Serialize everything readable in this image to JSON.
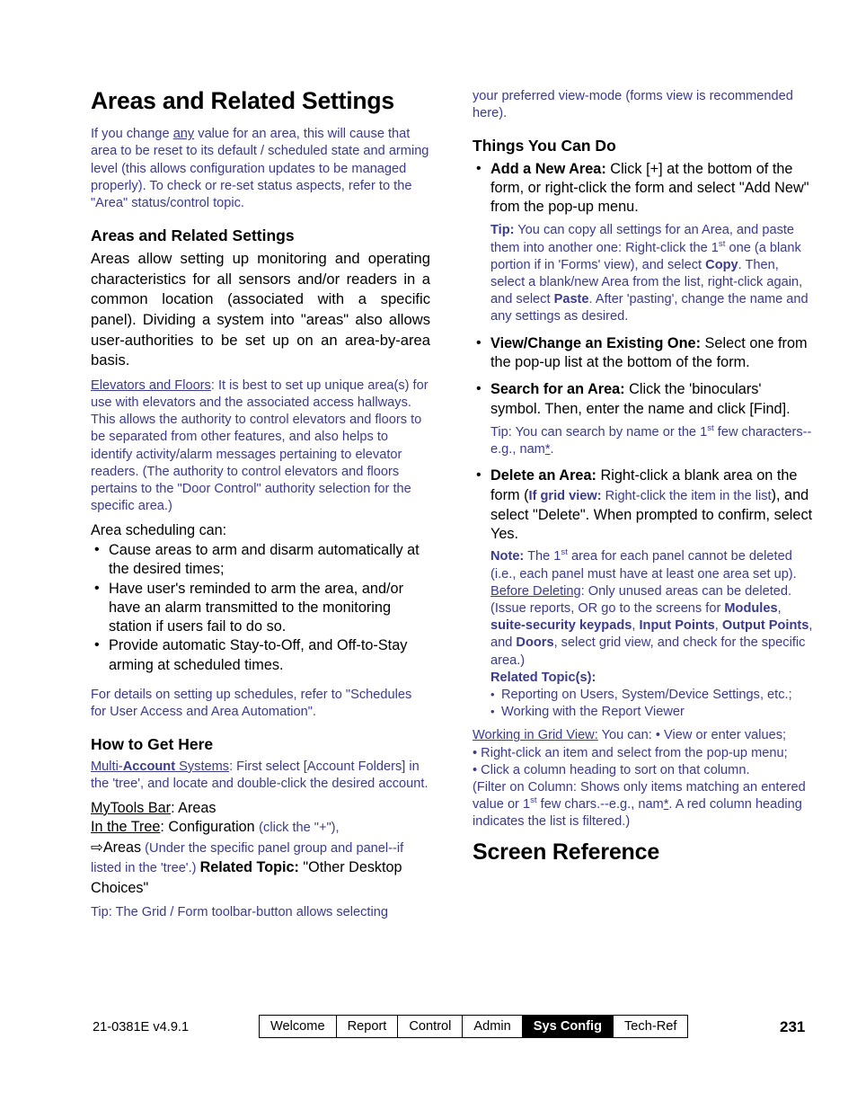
{
  "document": {
    "title": "Areas and Related Settings",
    "page_number": "231",
    "doc_id": "21-0381E v4.9.1"
  },
  "left_column": {
    "intro": {
      "t1": "If you change ",
      "u1": "any",
      "t2": " value for an area, this will cause that area to be reset to its default / scheduled state and arming level (this allows configuration updates to be managed properly).  To check or re-set status aspects, refer to the \"Area\" status/control topic."
    },
    "heading_areas": "Areas and Related Settings",
    "body_areas": "Areas allow setting up monitoring and operating characteristics for all sensors and/or readers in a common location (associated with a specific panel).   Dividing a system into \"areas\" also allows user-authorities to be set up on an area-by-area basis.",
    "elevators": {
      "label": "Elevators and Floors",
      "text": ":  It is best to set up unique area(s) for use with elevators and the associated access hallways.  This allows the authority to control elevators and floors to be separated from other features, and also helps to identify activity/alarm messages pertaining to elevator readers.  (The authority to control elevators and floors pertains to the \"Door Control\" authority selection for the specific area.)"
    },
    "scheduling_lead": "Area scheduling can:",
    "scheduling_bullets": [
      "Cause areas to arm and disarm automatically at the desired times;",
      "Have user's reminded to arm the area, and/or have an alarm transmitted to the monitoring station if users fail to do so.",
      "Provide automatic Stay-to-Off, and Off-to-Stay arming at scheduled times."
    ],
    "schedules_ref": "For details on setting up schedules, refer to \"Schedules for User Access and Area Automation\".",
    "heading_how": "How to Get Here",
    "multi_account": {
      "u_pre": "Multi-",
      "u_bold": "Account",
      "u_post": " Systems",
      "text": ":  First select [Account Folders] in the 'tree', and locate and double-click the desired account."
    },
    "mytools": {
      "label": "MyTools Bar",
      "text": ":  Areas"
    },
    "in_the_tree": {
      "label": "In the Tree",
      "text": ":  Configuration ",
      "paren": "(click the \"+\"),"
    },
    "areas_line": {
      "arrow": "⇨",
      "areas": "Areas",
      "paren": " (Under the specific panel group and panel--if listed in the 'tree'.) ",
      "related_topic_label": "Related Topic:",
      "related_topic_value": "  \"Other Desktop Choices\""
    },
    "tip_grid": "Tip:  The Grid / Form toolbar-button allows selecting"
  },
  "right_column": {
    "continued": "your preferred view-mode (forms view is recommended here).",
    "heading_things": "Things You Can Do",
    "add_new": {
      "label": "Add a New Area:",
      "text": "  Click [+] at the bottom of the form, or right-click the form and select \"Add New\" from the pop-up menu."
    },
    "add_new_tip": {
      "label": "Tip:",
      "p1": "  You can copy all settings for an Area, and paste them into another one:  Right-click the 1",
      "sup1": "st",
      "p2": " one (a blank portion if in 'Forms' view), and select ",
      "b1": "Copy",
      "p3": ".  Then, select a blank/new Area from the list, right-click again, and select ",
      "b2": "Paste",
      "p4": ".  After 'pasting', change the name and any settings as desired."
    },
    "view_change": {
      "label": "View/Change an Existing One:",
      "text": "  Select one from the pop-up list at the bottom of the form."
    },
    "search": {
      "label": "Search for an Area:",
      "text": "  Click the 'binoculars' symbol.  Then, enter the name and click [Find]."
    },
    "search_tip": {
      "p1": "Tip:  You can search by name or the 1",
      "sup1": "st",
      "p2": " few characters--e.g., nam",
      "u1": "*",
      "p3": "."
    },
    "delete": {
      "label": "Delete an Area:",
      "t1": "  Right-click a blank area on the form (",
      "blue_bold": "If grid view:",
      "blue_text": " Right-click the item in the list",
      "t2": "), and select \"Delete\".  When prompted to confirm, select Yes."
    },
    "delete_note": {
      "label": "Note:",
      "p1": "  The 1",
      "sup1": "st",
      "p2": " area for each panel cannot be deleted (i.e., each panel must have at least one area set up)."
    },
    "before_deleting": {
      "label": "Before Deleting",
      "p1": ":  Only unused areas can be deleted. (Issue reports, OR go to the screens for ",
      "b1": "Modules",
      "p2": ", ",
      "b2": "suite-security keypads",
      "p3": ", ",
      "b3": "Input Points",
      "p4": ", ",
      "b4": "Output Points",
      "p5": ", and ",
      "b5": "Doors",
      "p6": ", select grid view, and check for the specific area.)"
    },
    "related_topics_label": "Related Topic(s):",
    "related_topics": [
      "Reporting on Users, System/Device Settings, etc.;",
      "Working with the Report Viewer"
    ],
    "grid_view": {
      "label": "Working in Grid View:",
      "p1": "  You can:  • View or enter values;",
      "p2": "• Right-click an item and select from the pop-up menu;",
      "p3": "• Click a column heading to sort on that column.",
      "p4": "(Filter on Column:  Shows only items matching an entered value or 1",
      "sup1": "st",
      "p5": " few chars.--e.g., nam",
      "u1": "*",
      "p6": ".  A red column heading indicates the list is filtered.)"
    },
    "heading_screen_ref": "Screen Reference"
  },
  "footer": {
    "tabs": [
      {
        "label": "Welcome",
        "active": false
      },
      {
        "label": "Report",
        "active": false
      },
      {
        "label": "Control",
        "active": false
      },
      {
        "label": "Admin",
        "active": false
      },
      {
        "label": "Sys Config",
        "active": true
      },
      {
        "label": "Tech-Ref",
        "active": false
      }
    ]
  }
}
